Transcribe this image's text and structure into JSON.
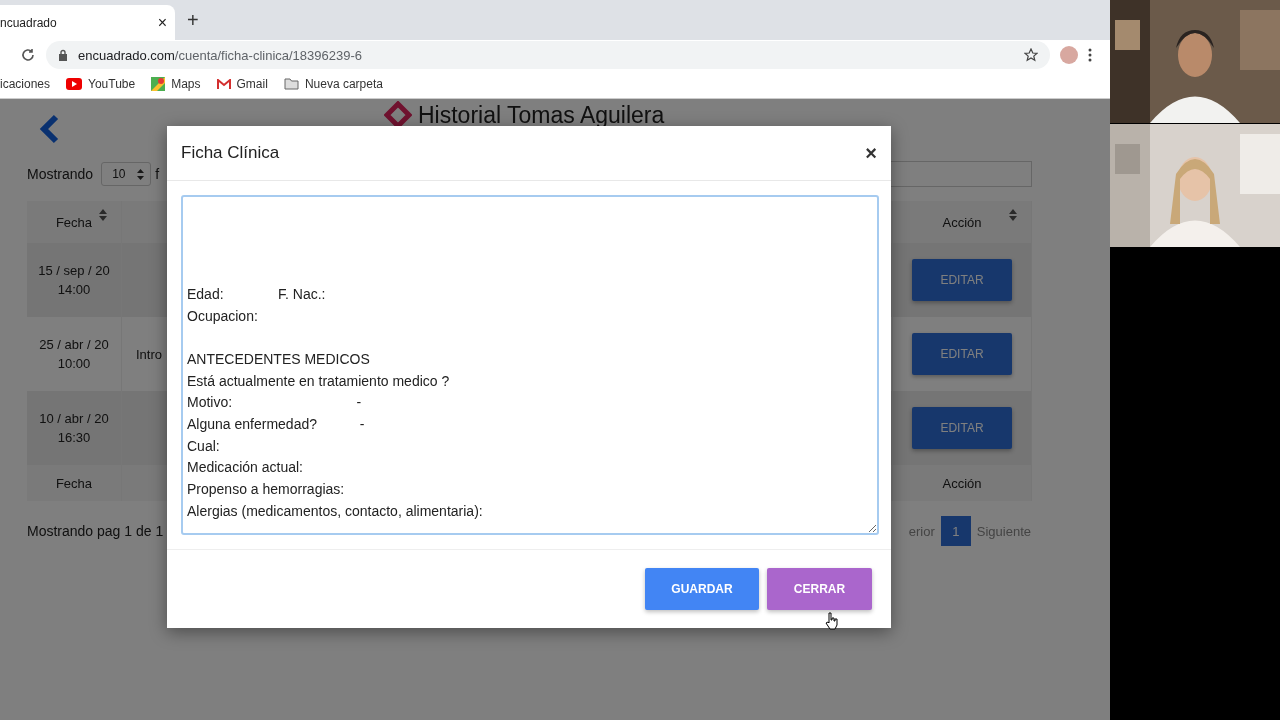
{
  "browser": {
    "tab": {
      "title": "ncuadrado",
      "close": "×"
    },
    "new_tab": "+",
    "url": {
      "domain": "encuadrado.com",
      "path": "/cuenta/ficha-clinica/18396239-6"
    },
    "bookmarks": [
      {
        "label": "icaciones",
        "kind": "none"
      },
      {
        "label": "YouTube",
        "kind": "youtube"
      },
      {
        "label": "Maps",
        "kind": "maps"
      },
      {
        "label": "Gmail",
        "kind": "gmail"
      },
      {
        "label": "Nueva carpeta",
        "kind": "folder"
      }
    ]
  },
  "page": {
    "title": "Historial Tomas Aguilera",
    "show_label": "Mostrando",
    "page_size": "10",
    "show_suffix": "f",
    "table": {
      "header": [
        "Fecha",
        "Acción"
      ],
      "rows": [
        {
          "date": "15 / sep / 20",
          "time": "14:00",
          "note": "",
          "action": "EDITAR"
        },
        {
          "date": "25 / abr / 20",
          "time": "10:00",
          "note": "Intro",
          "action": "EDITAR"
        },
        {
          "date": "10 / abr / 20",
          "time": "16:30",
          "note": "",
          "action": "EDITAR"
        }
      ],
      "footer": [
        "Fecha",
        "Acción"
      ]
    },
    "pagination": {
      "summary": "Mostrando pag 1 de 1",
      "previous": "erior",
      "pages": [
        {
          "label": "1",
          "selected": true
        }
      ],
      "next": "Siguiente"
    }
  },
  "modal": {
    "title": "Ficha Clínica",
    "close": "×",
    "notes": "\n\n\n\nEdad:              F. Nac.:\nOcupacion: \n\nANTECEDENTES MEDICOS\nEstá actualmente en tratamiento medico ?\nMotivo:                                -\nAlguna enfermedad?           -\nCual:\nMedicación actual:\nPropenso a hemorragias:\nAlergias (medicamentos, contacto, alimentaria):",
    "buttons": [
      {
        "label": "GUARDAR",
        "kind": "primary"
      },
      {
        "label": "CERRAR",
        "kind": "secondary"
      }
    ]
  }
}
